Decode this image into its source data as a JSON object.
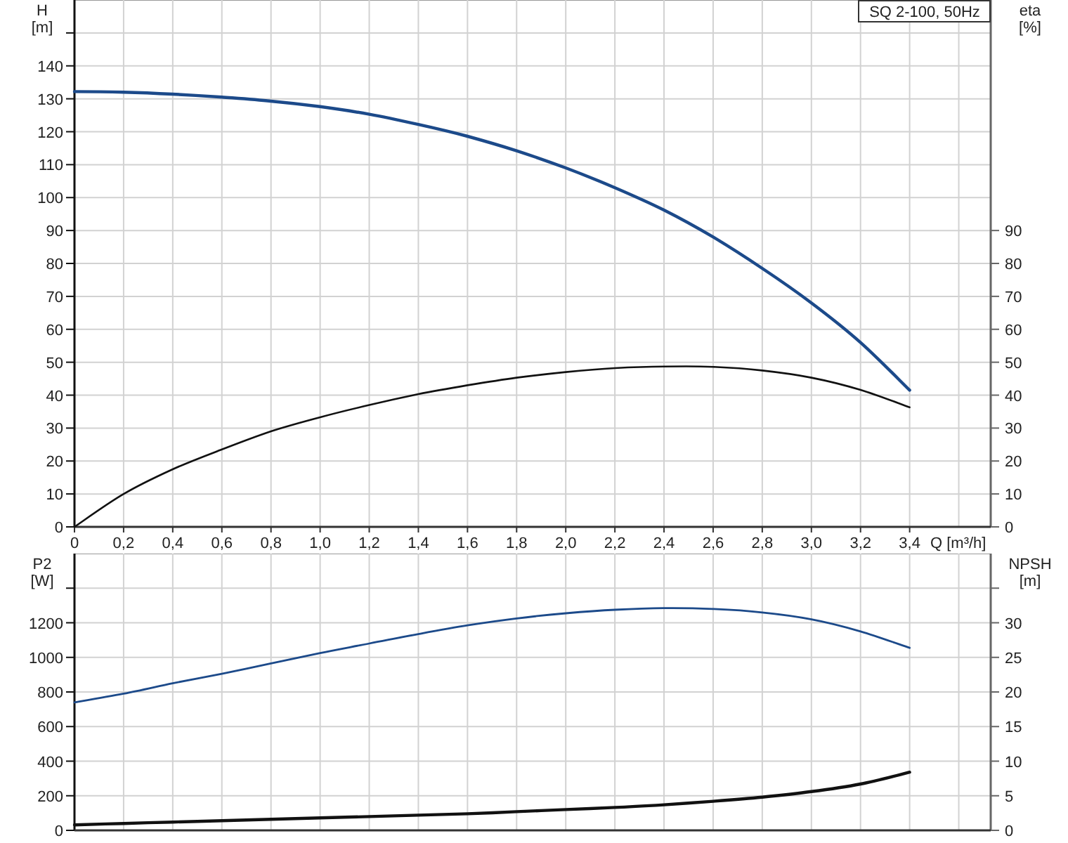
{
  "head_chart": {
    "chart_data": {
      "type": "line",
      "title": "SQ 2-100, 50Hz",
      "xlabel": "Q [m³/h]",
      "ylabel": "H [m]",
      "y2label": "eta [%]",
      "grid": true,
      "x": [
        0,
        0.2,
        0.4,
        0.6,
        0.8,
        1.0,
        1.2,
        1.4,
        1.6,
        1.8,
        2.0,
        2.2,
        2.4,
        2.6,
        2.8,
        3.0,
        3.2,
        3.4
      ],
      "series": [
        {
          "color": "#1c4a8a",
          "values": [
            132.2,
            132,
            131.4,
            130.5,
            129.3,
            127.6,
            125.3,
            122.2,
            118.6,
            114.2,
            109,
            103,
            96.2,
            88,
            78.5,
            68,
            56,
            41.5
          ]
        },
        {
          "color": "#111111",
          "values": [
            0,
            10,
            17.5,
            23.5,
            29,
            33.3,
            37,
            40.3,
            43,
            45.3,
            47,
            48.2,
            48.7,
            48.6,
            47.5,
            45.3,
            41.6,
            36.3
          ]
        }
      ],
      "xlim": [
        0,
        3.73
      ],
      "ylim": [
        0,
        160
      ],
      "y2lim": [
        0,
        160
      ],
      "xticks": [
        {
          "value": 0,
          "label": "0"
        },
        {
          "value": 0.2,
          "label": "0,2"
        },
        {
          "value": 0.4,
          "label": "0,4"
        },
        {
          "value": 0.6,
          "label": "0,6"
        },
        {
          "value": 0.8,
          "label": "0,8"
        },
        {
          "value": 1.0,
          "label": "1,0"
        },
        {
          "value": 1.2,
          "label": "1,2"
        },
        {
          "value": 1.4,
          "label": "1,4"
        },
        {
          "value": 1.6,
          "label": "1,6"
        },
        {
          "value": 1.8,
          "label": "1,8"
        },
        {
          "value": 2.0,
          "label": "2,0"
        },
        {
          "value": 2.2,
          "label": "2,2"
        },
        {
          "value": 2.4,
          "label": "2,4"
        },
        {
          "value": 2.6,
          "label": "2,6"
        },
        {
          "value": 2.8,
          "label": "2,8"
        },
        {
          "value": 3.0,
          "label": "3,0"
        },
        {
          "value": 3.2,
          "label": "3,2"
        },
        {
          "value": 3.4,
          "label": "3,4"
        }
      ],
      "yticks": [
        0,
        10,
        20,
        30,
        40,
        50,
        60,
        70,
        80,
        90,
        100,
        110,
        120,
        130,
        140
      ],
      "y2ticks": [
        0,
        10,
        20,
        30,
        40,
        50,
        60,
        70,
        80,
        90
      ]
    }
  },
  "power_chart": {
    "chart_data": {
      "type": "line",
      "ylabel": "P2 [W]",
      "y2label": "NPSH [m]",
      "grid": true,
      "x": [
        0,
        0.2,
        0.4,
        0.6,
        0.8,
        1.0,
        1.2,
        1.4,
        1.6,
        1.8,
        2.0,
        2.2,
        2.4,
        2.6,
        2.8,
        3.0,
        3.2,
        3.4
      ],
      "series": [
        {
          "color": "#1c4a8a",
          "values": [
            740,
            790,
            850,
            905,
            965,
            1025,
            1080,
            1135,
            1185,
            1225,
            1255,
            1275,
            1285,
            1280,
            1260,
            1220,
            1150,
            1055
          ]
        },
        {
          "color": "#111111",
          "axis": "y2",
          "values": [
            0.8,
            1.0,
            1.2,
            1.4,
            1.6,
            1.8,
            2.0,
            2.2,
            2.4,
            2.7,
            3.0,
            3.3,
            3.7,
            4.2,
            4.8,
            5.6,
            6.7,
            8.4
          ]
        }
      ],
      "xlim": [
        0,
        3.73
      ],
      "ylim": [
        0,
        1600
      ],
      "y2lim": [
        0,
        40
      ],
      "yticks": [
        0,
        200,
        400,
        600,
        800,
        1000,
        1200
      ],
      "y2ticks": [
        0,
        5,
        10,
        15,
        20,
        25,
        30
      ]
    }
  }
}
